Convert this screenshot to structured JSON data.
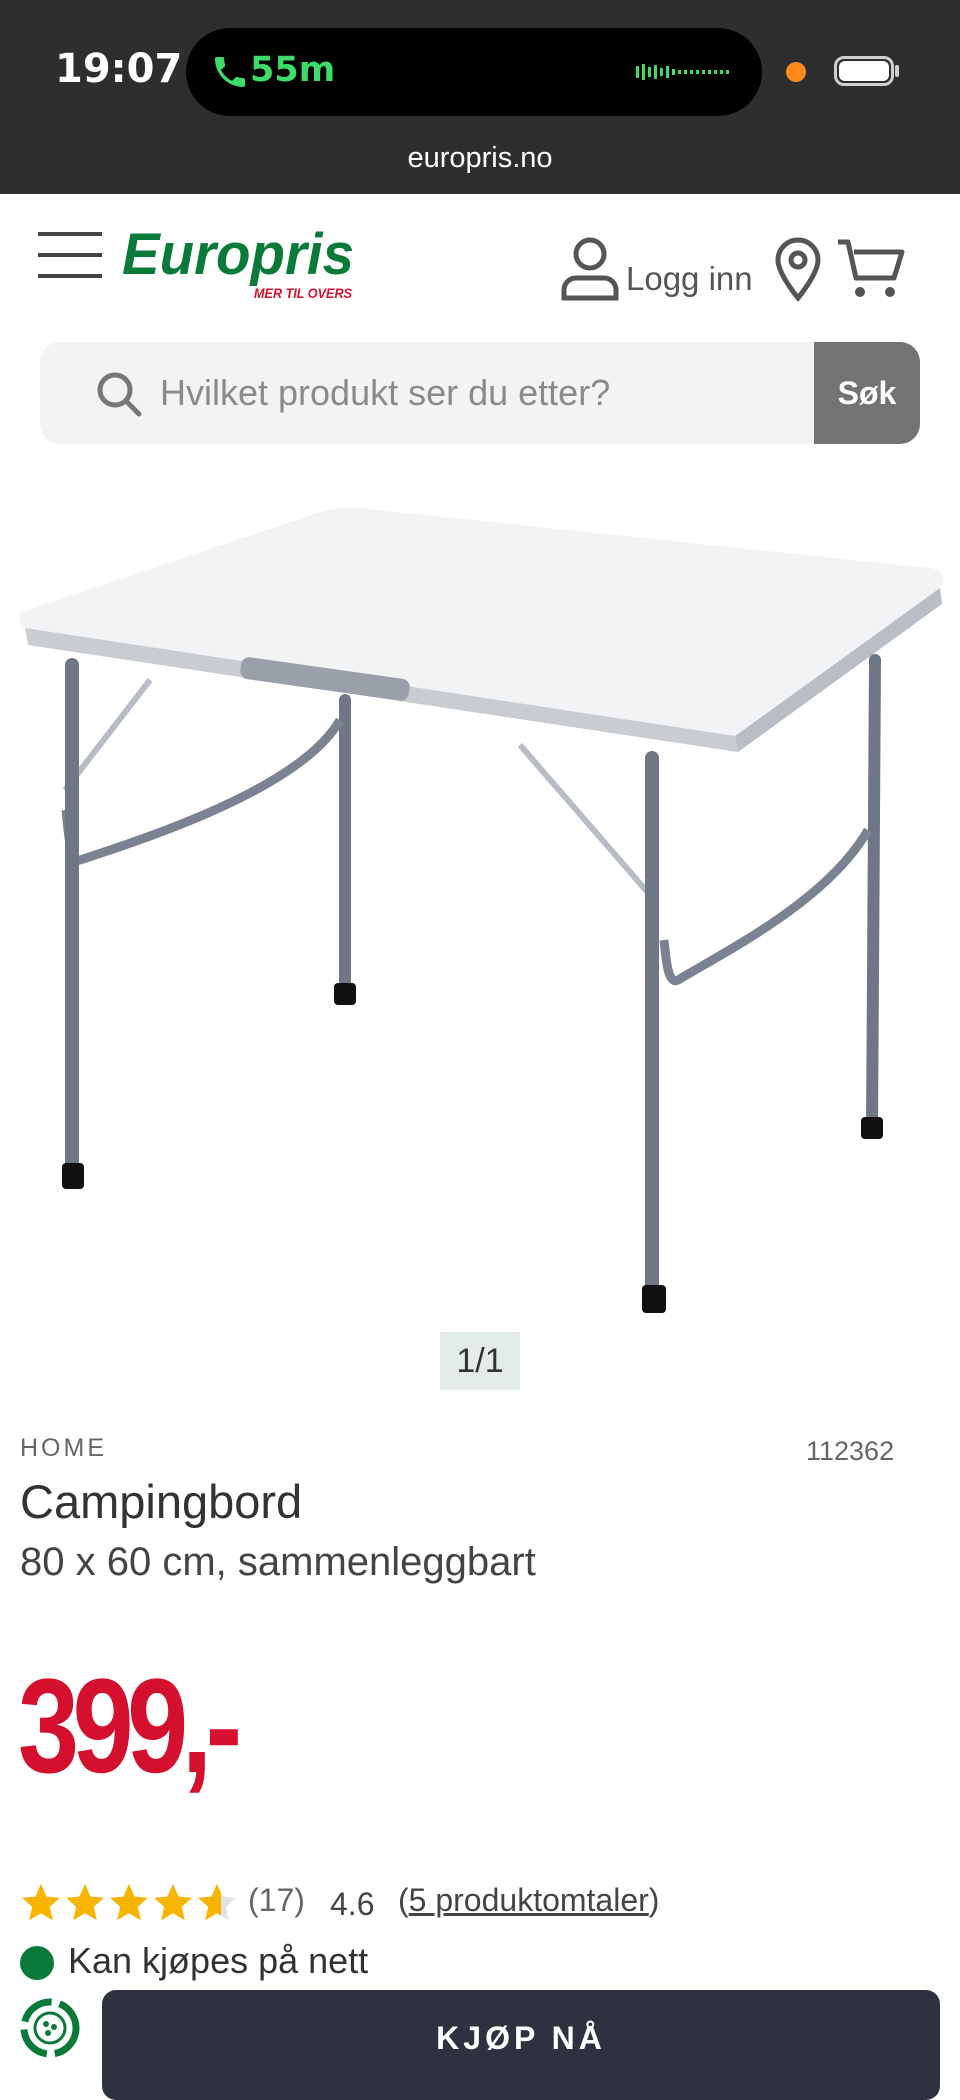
{
  "status_bar": {
    "time": "19:07",
    "call_duration": "55m",
    "url": "europris.no"
  },
  "header": {
    "logo_text": "Europris",
    "logo_tagline": "MER TIL OVERS",
    "login_label": "Logg inn"
  },
  "search": {
    "placeholder": "Hvilket produkt ser du etter?",
    "button_label": "Søk"
  },
  "gallery": {
    "counter": "1/1"
  },
  "product": {
    "category": "HOME",
    "sku": "112362",
    "title": "Campingbord",
    "subtitle": "80 x 60 cm, sammenleggbart",
    "price": "399,-",
    "rating_stars": 4.6,
    "review_count": "(17)",
    "rating_value": "4.6",
    "reviews_link_open": "(",
    "reviews_link_text": "5 produktomtaler",
    "reviews_link_close": ")",
    "availability": "Kan kjøpes på nett",
    "buy_label": "KJØP NÅ"
  },
  "colors": {
    "brand_green": "#0a7a3a",
    "brand_red": "#d4102e",
    "dark_button": "#2e3240"
  }
}
